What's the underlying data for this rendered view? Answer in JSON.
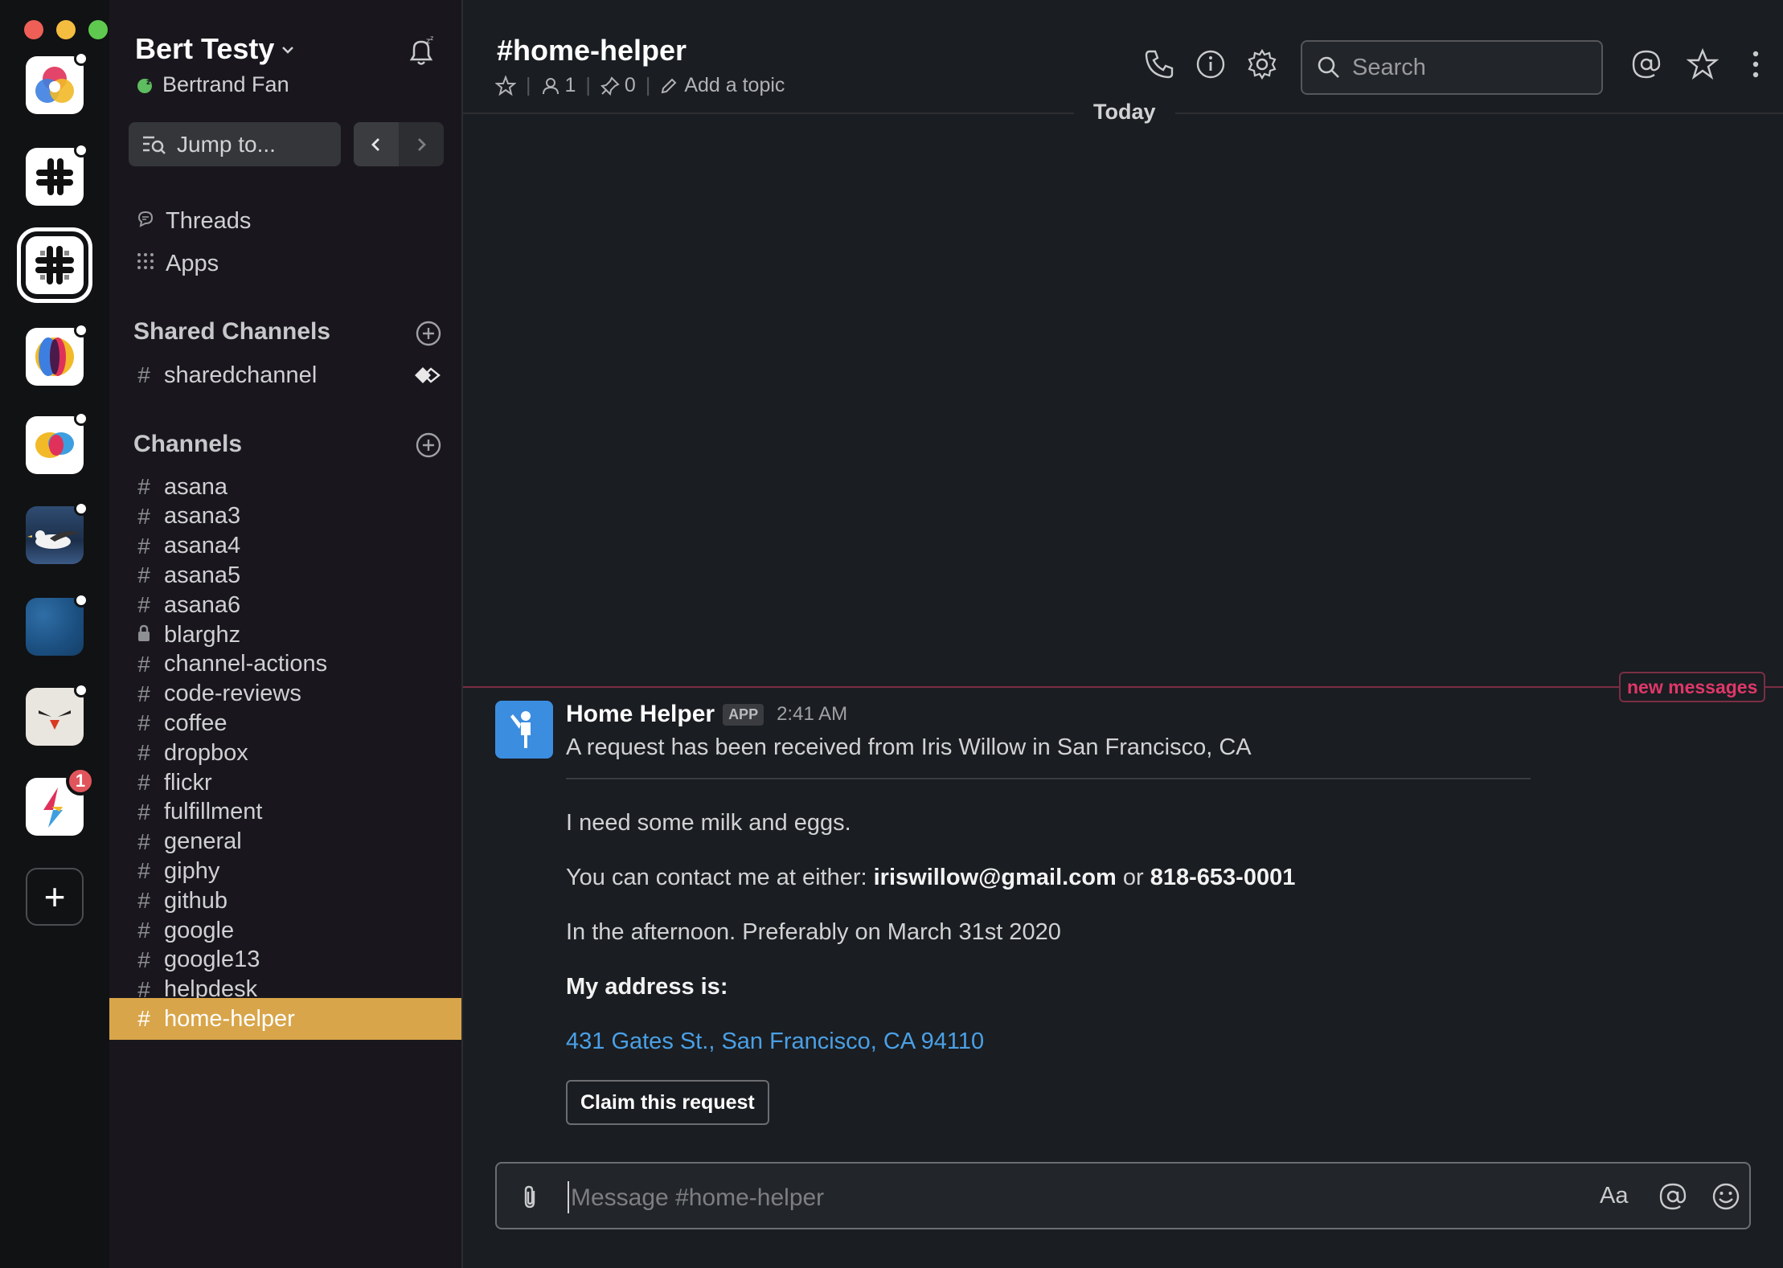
{
  "colors": {
    "accent_selected": "#d9a54a",
    "link": "#4aa0e6",
    "new_messages": "#e0376a",
    "bot_avatar": "#3b8de0",
    "presence": "#5dbd5f"
  },
  "rail": {
    "workspaces": [
      {
        "name": "workspace-1",
        "icon": "tri-circle-logo",
        "has_dot": true
      },
      {
        "name": "workspace-2",
        "icon": "slack-logo",
        "has_dot": true
      },
      {
        "name": "workspace-3",
        "icon": "slack-checkered-logo",
        "active": true
      },
      {
        "name": "workspace-4",
        "icon": "orbit-logo",
        "has_dot": true
      },
      {
        "name": "workspace-5",
        "icon": "chat-bubble-logo",
        "has_dot": true
      },
      {
        "name": "workspace-6",
        "icon": "seabird-photo",
        "has_dot": true
      },
      {
        "name": "workspace-7",
        "icon": "blue-texture",
        "has_dot": true
      },
      {
        "name": "workspace-8",
        "icon": "bird-face-logo",
        "has_dot": true
      },
      {
        "name": "workspace-9",
        "icon": "lightning-logo",
        "badge": "1"
      }
    ],
    "add_label": "+"
  },
  "sidebar": {
    "team_name": "Bert Testy",
    "user_name": "Bertrand Fan",
    "jump_label": "Jump to...",
    "top_items": [
      {
        "label": "Threads",
        "icon": "threads-icon"
      },
      {
        "label": "Apps",
        "icon": "apps-icon"
      }
    ],
    "shared_heading": "Shared Channels",
    "shared_channels": [
      {
        "name": "sharedchannel"
      }
    ],
    "channels_heading": "Channels",
    "channels": [
      {
        "name": "asana"
      },
      {
        "name": "asana3"
      },
      {
        "name": "asana4"
      },
      {
        "name": "asana5"
      },
      {
        "name": "asana6"
      },
      {
        "name": "blarghz",
        "private": true
      },
      {
        "name": "channel-actions"
      },
      {
        "name": "code-reviews"
      },
      {
        "name": "coffee"
      },
      {
        "name": "dropbox"
      },
      {
        "name": "flickr"
      },
      {
        "name": "fulfillment"
      },
      {
        "name": "general"
      },
      {
        "name": "giphy"
      },
      {
        "name": "github"
      },
      {
        "name": "google"
      },
      {
        "name": "google13"
      },
      {
        "name": "helpdesk"
      },
      {
        "name": "home-helper",
        "selected": true
      }
    ]
  },
  "header": {
    "channel_title": "#home-helper",
    "member_count": "1",
    "pinned_count": "0",
    "add_topic": "Add a topic",
    "search_placeholder": "Search"
  },
  "messages": {
    "day_label": "Today",
    "new_messages_label": "new messages",
    "sender": "Home Helper",
    "app_tag": "APP",
    "time": "2:41 AM",
    "line1": "A request has been received from Iris Willow in San Francisco, CA",
    "line2": "I need some milk and eggs.",
    "contact_prefix": "You can contact me at either: ",
    "contact_email": "iriswillow@gmail.com",
    "contact_or": " or ",
    "contact_phone": "818-653-0001",
    "line4": "In the afternoon. Preferably on March 31st 2020",
    "address_label": "My address is:",
    "address": "431 Gates St., San Francisco, CA 94110",
    "claim_button": "Claim this request"
  },
  "composer": {
    "placeholder": "Message #home-helper",
    "format_label": "Aa"
  }
}
